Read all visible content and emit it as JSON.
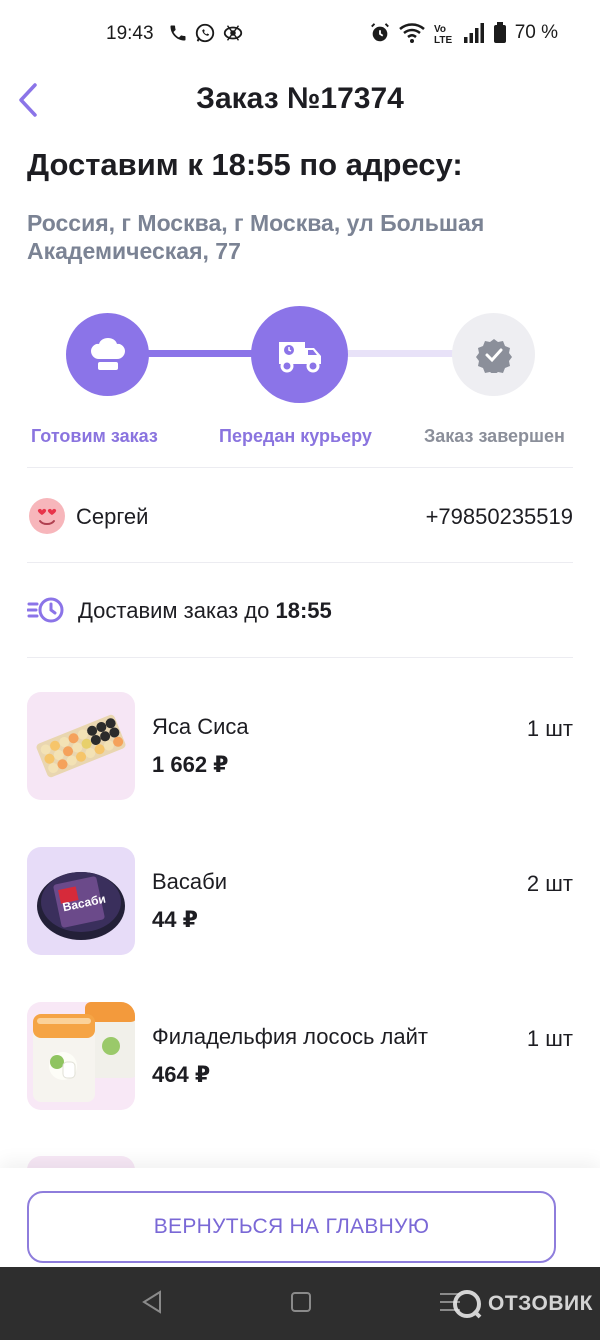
{
  "status_bar": {
    "time": "19:43",
    "battery": "70 %",
    "left_icons": [
      "phone-icon",
      "whatsapp-icon",
      "app-icon"
    ],
    "right_icons": [
      "alarm-icon",
      "wifi-icon",
      "volte-icon",
      "signal-icon",
      "battery-icon"
    ]
  },
  "header": {
    "title": "Заказ №17374",
    "back_icon": "chevron-left-icon"
  },
  "delivery": {
    "heading": "Доставим к 18:55 по адресу:",
    "address": "Россия, г Москва, г Москва, ул Большая Академическая, 77"
  },
  "progress": {
    "steps": [
      {
        "label": "Готовим заказ",
        "icon": "chef-hat-icon",
        "state": "done"
      },
      {
        "label": "Передан курьеру",
        "icon": "delivery-truck-icon",
        "state": "active"
      },
      {
        "label": "Заказ завершен",
        "icon": "check-badge-icon",
        "state": "pending"
      }
    ],
    "current_step": 2,
    "colors": {
      "active": "#8b74e8",
      "active_text": "#8a74df",
      "pending": "#eeeeF2",
      "pending_text": "#8b8f9a",
      "track_pending": "#e8e2f8"
    }
  },
  "courier": {
    "name": "Сергей",
    "phone": "+79850235519",
    "avatar_icon": "heart-eyes-emoji-icon"
  },
  "eta": {
    "text": "Доставим заказ до ",
    "time": "18:55",
    "icon": "fast-clock-icon"
  },
  "items": [
    {
      "name": "Яса Сиса",
      "price": "1 662 ₽",
      "qty": "1 шт",
      "thumb_bg": "#f6e6f5"
    },
    {
      "name": "Васаби",
      "price": "44 ₽",
      "qty": "2 шт",
      "thumb_bg": "#e7dcf8",
      "thumb_text": "Васаби"
    },
    {
      "name": "Филадельфия лосось лайт",
      "price": "464 ₽",
      "qty": "1 шт",
      "thumb_bg": "#f8e8f6"
    }
  ],
  "actions": {
    "home_button": "ВЕРНУТЬСЯ НА ГЛАВНУЮ"
  },
  "watermark": {
    "text": "ОТЗОВИК"
  }
}
